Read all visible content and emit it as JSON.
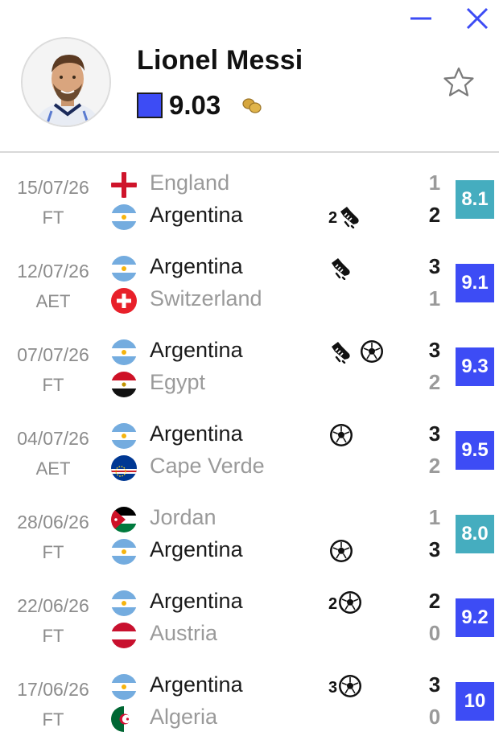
{
  "window": {
    "minimize_icon": "minimize-icon",
    "close_icon": "close-icon",
    "accent": "#3d4cf5"
  },
  "player": {
    "name": "Lionel Messi",
    "rating": "9.03",
    "rating_color": "#3d4cf5"
  },
  "matches": [
    {
      "date": "15/07/26",
      "status": "FT",
      "t1": {
        "name": "England",
        "flag": "england",
        "result": "lose",
        "score": "1",
        "events": []
      },
      "t2": {
        "name": "Argentina",
        "flag": "argentina",
        "result": "win",
        "score": "2",
        "events": [
          {
            "count": "2",
            "type": "assist"
          }
        ]
      },
      "rating": "8.1",
      "rating_color": "#45adbf"
    },
    {
      "date": "12/07/26",
      "status": "AET",
      "t1": {
        "name": "Argentina",
        "flag": "argentina",
        "result": "win",
        "score": "3",
        "events": [
          {
            "count": "",
            "type": "assist"
          }
        ]
      },
      "t2": {
        "name": "Switzerland",
        "flag": "switzerland",
        "result": "lose",
        "score": "1",
        "events": []
      },
      "rating": "9.1",
      "rating_color": "#3d4cf5"
    },
    {
      "date": "07/07/26",
      "status": "FT",
      "t1": {
        "name": "Argentina",
        "flag": "argentina",
        "result": "win",
        "score": "3",
        "events": [
          {
            "count": "",
            "type": "assist"
          },
          {
            "count": "",
            "type": "goal"
          }
        ]
      },
      "t2": {
        "name": "Egypt",
        "flag": "egypt",
        "result": "lose",
        "score": "2",
        "events": []
      },
      "rating": "9.3",
      "rating_color": "#3d4cf5"
    },
    {
      "date": "04/07/26",
      "status": "AET",
      "t1": {
        "name": "Argentina",
        "flag": "argentina",
        "result": "win",
        "score": "3",
        "events": [
          {
            "count": "",
            "type": "goal"
          }
        ]
      },
      "t2": {
        "name": "Cape Verde",
        "flag": "capeverde",
        "result": "lose",
        "score": "2",
        "events": []
      },
      "rating": "9.5",
      "rating_color": "#3d4cf5"
    },
    {
      "date": "28/06/26",
      "status": "FT",
      "t1": {
        "name": "Jordan",
        "flag": "jordan",
        "result": "lose",
        "score": "1",
        "events": []
      },
      "t2": {
        "name": "Argentina",
        "flag": "argentina",
        "result": "win",
        "score": "3",
        "events": [
          {
            "count": "",
            "type": "goal"
          }
        ]
      },
      "rating": "8.0",
      "rating_color": "#45adbf"
    },
    {
      "date": "22/06/26",
      "status": "FT",
      "t1": {
        "name": "Argentina",
        "flag": "argentina",
        "result": "win",
        "score": "2",
        "events": [
          {
            "count": "2",
            "type": "goal"
          }
        ]
      },
      "t2": {
        "name": "Austria",
        "flag": "austria",
        "result": "lose",
        "score": "0",
        "events": []
      },
      "rating": "9.2",
      "rating_color": "#3d4cf5"
    },
    {
      "date": "17/06/26",
      "status": "FT",
      "t1": {
        "name": "Argentina",
        "flag": "argentina",
        "result": "win",
        "score": "3",
        "events": [
          {
            "count": "3",
            "type": "goal"
          }
        ]
      },
      "t2": {
        "name": "Algeria",
        "flag": "algeria",
        "result": "lose",
        "score": "0",
        "events": []
      },
      "rating": "10",
      "rating_color": "#3d4cf5"
    }
  ]
}
